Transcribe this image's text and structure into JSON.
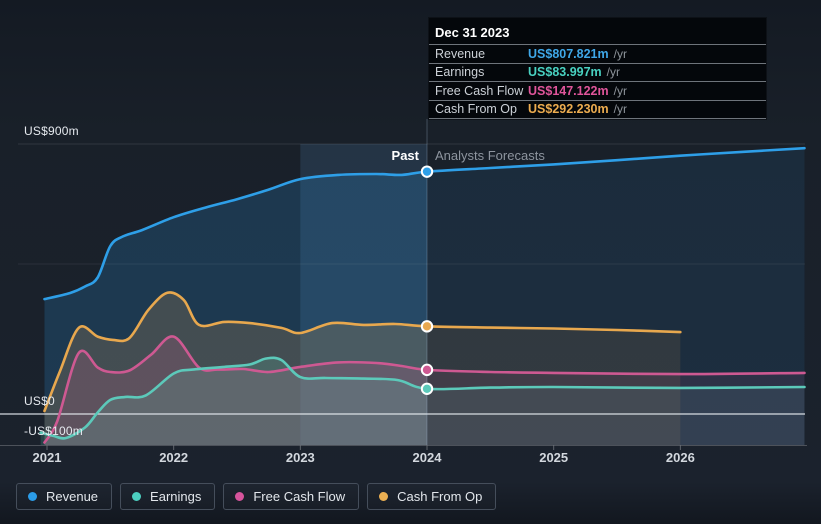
{
  "tooltip": {
    "title": "Dec 31 2023",
    "rows": [
      {
        "label": "Revenue",
        "value": "US$807.821m",
        "suffix": "/yr",
        "color": "#3fa7e8"
      },
      {
        "label": "Earnings",
        "value": "US$83.997m",
        "suffix": "/yr",
        "color": "#49d1c1"
      },
      {
        "label": "Free Cash Flow",
        "value": "US$147.122m",
        "suffix": "/yr",
        "color": "#e0559a"
      },
      {
        "label": "Cash From Op",
        "value": "US$292.230m",
        "suffix": "/yr",
        "color": "#edac4f"
      }
    ]
  },
  "chart": {
    "past_label": "Past",
    "forecast_label": "Analysts Forecasts",
    "y_axis_labels": [
      "US$900m",
      "US$0",
      "-US$100m"
    ],
    "x_tick_labels": [
      "2021",
      "2022",
      "2023",
      "2024",
      "2025",
      "2026"
    ]
  },
  "legend": [
    {
      "label": "Revenue",
      "color": "#2b9ce8"
    },
    {
      "label": "Earnings",
      "color": "#4ccfc0"
    },
    {
      "label": "Free Cash Flow",
      "color": "#d6549c"
    },
    {
      "label": "Cash From Op",
      "color": "#ebaf52"
    }
  ],
  "chart_data": {
    "type": "area",
    "title": "Past and Analysts Forecasts revenue, earnings and cash flow growth",
    "x_unit": "year",
    "xlim": [
      2020.95,
      2027
    ],
    "ylim": [
      -103,
      900
    ],
    "y_unit": "US$m",
    "y_gridline_values": [
      900,
      500,
      0,
      -100
    ],
    "past_forecast_boundary": 2024,
    "highlight_band": [
      2023,
      2024
    ],
    "hover_point_date": "Dec 31 2023",
    "legend_position": "bottom-left",
    "series": [
      {
        "name": "Revenue",
        "key": "revenue",
        "color": "#2E9FE8",
        "points": [
          [
            2020.98,
            383
          ],
          [
            2021.18,
            403
          ],
          [
            2021.3,
            425
          ],
          [
            2021.4,
            455
          ],
          [
            2021.5,
            560
          ],
          [
            2021.6,
            592
          ],
          [
            2021.75,
            613
          ],
          [
            2022,
            656
          ],
          [
            2022.25,
            688
          ],
          [
            2022.5,
            716
          ],
          [
            2022.75,
            748
          ],
          [
            2023,
            783
          ],
          [
            2023.3,
            797
          ],
          [
            2023.6,
            800
          ],
          [
            2023.8,
            797
          ],
          [
            2024,
            807.821
          ],
          [
            2024.5,
            820
          ],
          [
            2025,
            832
          ],
          [
            2025.5,
            846
          ],
          [
            2026,
            861
          ],
          [
            2026.5,
            874
          ],
          [
            2026.98,
            886
          ]
        ]
      },
      {
        "name": "Cash From Op",
        "key": "cashop",
        "color": "#E8A84E",
        "points": [
          [
            2020.98,
            10
          ],
          [
            2021.1,
            140
          ],
          [
            2021.25,
            287
          ],
          [
            2021.4,
            258
          ],
          [
            2021.52,
            247
          ],
          [
            2021.65,
            253
          ],
          [
            2021.8,
            347
          ],
          [
            2021.95,
            404
          ],
          [
            2022.08,
            380
          ],
          [
            2022.2,
            297
          ],
          [
            2022.4,
            307
          ],
          [
            2022.6,
            303
          ],
          [
            2022.85,
            287
          ],
          [
            2023,
            270
          ],
          [
            2023.25,
            303
          ],
          [
            2023.5,
            297
          ],
          [
            2023.75,
            300
          ],
          [
            2024,
            292.23
          ],
          [
            2024.5,
            288
          ],
          [
            2025,
            285
          ],
          [
            2025.5,
            280
          ],
          [
            2026,
            273
          ]
        ]
      },
      {
        "name": "Free Cash Flow",
        "key": "fcf",
        "color": "#CE5992",
        "points": [
          [
            2020.98,
            -95
          ],
          [
            2021.08,
            -25
          ],
          [
            2021.25,
            203
          ],
          [
            2021.4,
            155
          ],
          [
            2021.5,
            140
          ],
          [
            2021.65,
            145
          ],
          [
            2021.82,
            197
          ],
          [
            2022,
            258
          ],
          [
            2022.2,
            155
          ],
          [
            2022.35,
            148
          ],
          [
            2022.55,
            150
          ],
          [
            2022.75,
            140
          ],
          [
            2023,
            157
          ],
          [
            2023.3,
            172
          ],
          [
            2023.6,
            170
          ],
          [
            2023.8,
            160
          ],
          [
            2024,
            147.122
          ],
          [
            2024.5,
            140
          ],
          [
            2025,
            137
          ],
          [
            2026,
            133
          ],
          [
            2026.98,
            137
          ]
        ]
      },
      {
        "name": "Earnings",
        "key": "earnings",
        "color": "#5CC9BA",
        "points": [
          [
            2020.95,
            -62
          ],
          [
            2021.05,
            -73
          ],
          [
            2021.15,
            -80
          ],
          [
            2021.3,
            -45
          ],
          [
            2021.4,
            5
          ],
          [
            2021.5,
            47
          ],
          [
            2021.62,
            57
          ],
          [
            2021.78,
            62
          ],
          [
            2022,
            135
          ],
          [
            2022.15,
            148
          ],
          [
            2022.4,
            157
          ],
          [
            2022.6,
            165
          ],
          [
            2022.73,
            185
          ],
          [
            2022.85,
            180
          ],
          [
            2023,
            123
          ],
          [
            2023.2,
            120
          ],
          [
            2023.5,
            118
          ],
          [
            2023.77,
            113
          ],
          [
            2024,
            83.997
          ],
          [
            2024.5,
            88
          ],
          [
            2025,
            90
          ],
          [
            2026,
            87
          ],
          [
            2026.98,
            90
          ]
        ]
      }
    ],
    "markers": [
      {
        "series": "revenue",
        "t": 2024,
        "value": 807.821
      },
      {
        "series": "cashop",
        "t": 2024,
        "value": 292.23
      },
      {
        "series": "fcf",
        "t": 2024,
        "value": 147.122
      },
      {
        "series": "earnings",
        "t": 2024,
        "value": 83.997
      }
    ]
  }
}
